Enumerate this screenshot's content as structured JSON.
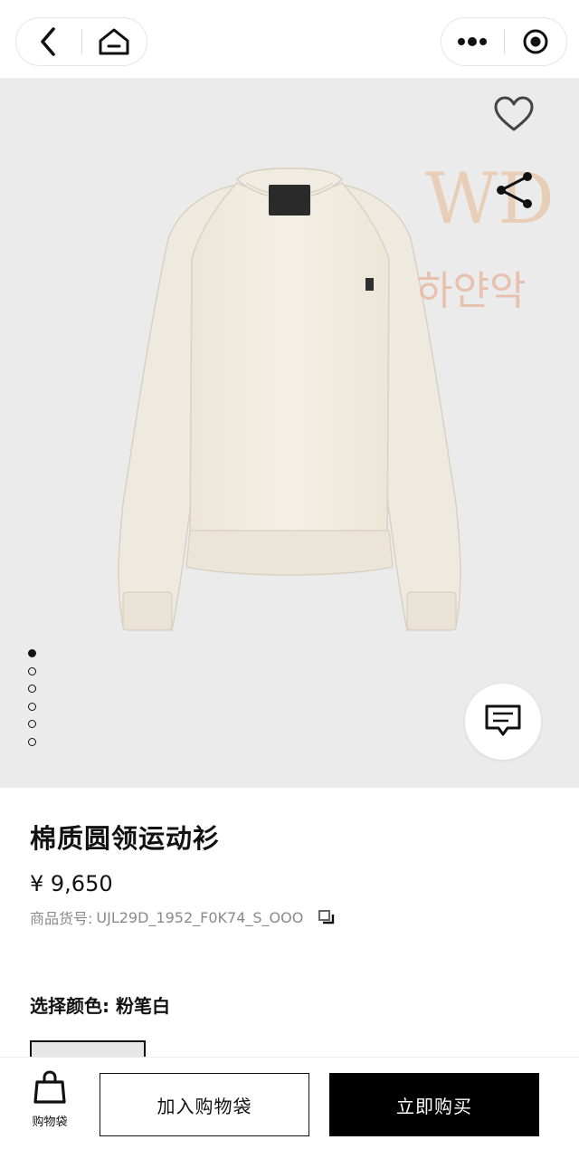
{
  "product": {
    "title": "棉质圆领运动衫",
    "price": "¥ 9,650",
    "sku_label": "商品货号:",
    "sku": "UJL29D_1952_F0K74_S_OOO",
    "color_line": "选择颜色: 粉笔白"
  },
  "gallery": {
    "image_count": 6,
    "active_index": 0,
    "background": "#ebebeb",
    "watermark_text_top": "WD",
    "watermark_text_bottom": "하얀악"
  },
  "bottom": {
    "bag_label": "购物袋",
    "add_to_bag": "加入购物袋",
    "buy_now": "立即购买"
  },
  "icons": {
    "back": "chevron-left-icon",
    "home": "home-icon",
    "more": "more-dots-icon",
    "close_miniprogram": "target-icon",
    "favorite": "heart-icon",
    "share": "share-icon",
    "chat": "chat-icon",
    "copy": "copy-icon",
    "bag": "shopping-bag-icon"
  },
  "colors": {
    "accent": "#000000",
    "muted": "#8a8a8a"
  }
}
